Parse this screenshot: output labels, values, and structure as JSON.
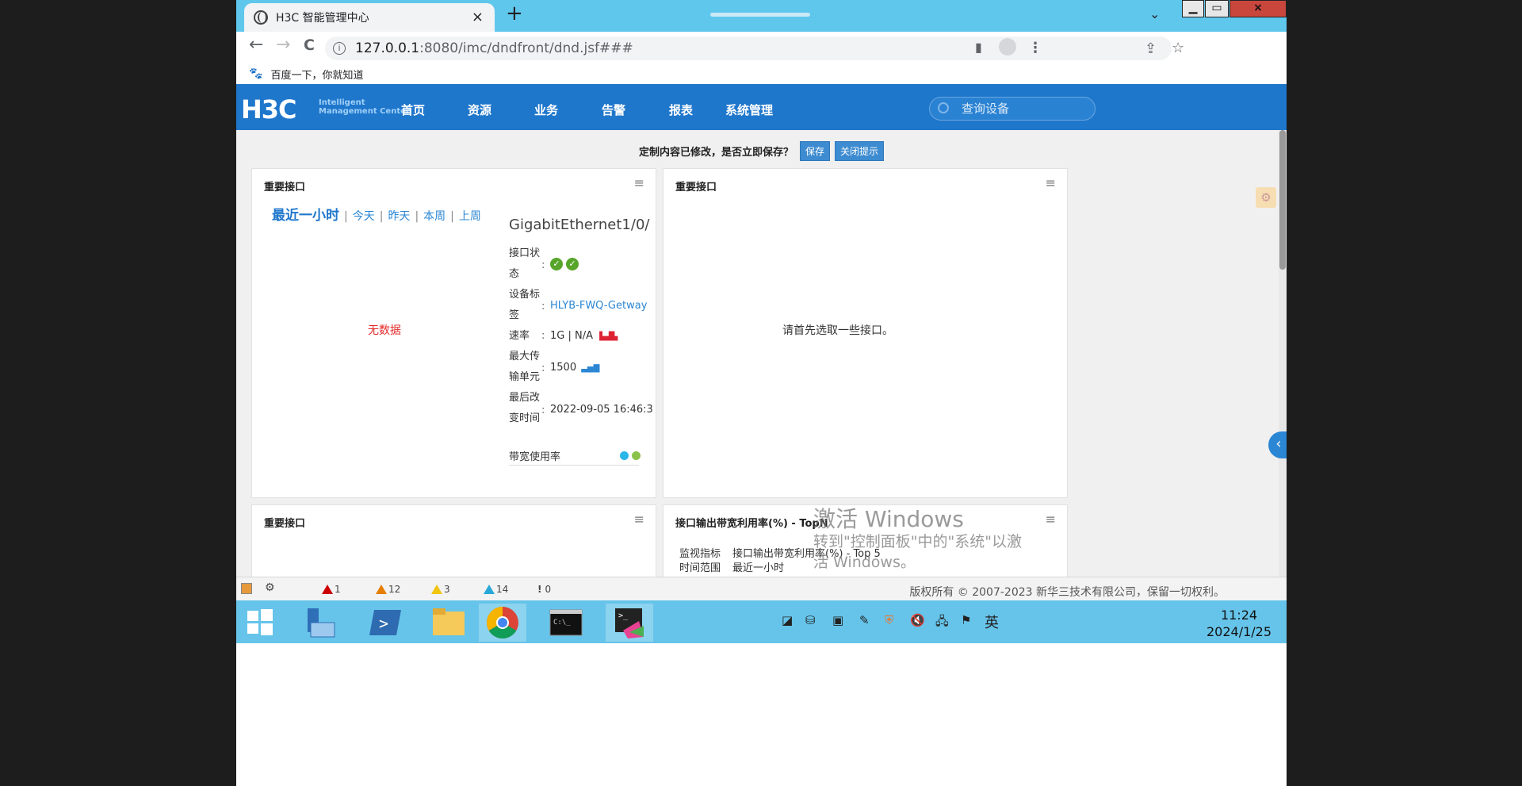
{
  "browser": {
    "tab_title": "H3C 智能管理中心",
    "tab_close": "×",
    "new_tab": "+",
    "tab_dropdown": "⌄",
    "win_min": "▁",
    "win_max": "▭",
    "win_close": "×",
    "back": "←",
    "forward": "→",
    "reload": "C",
    "url_host": "127.0.0.1",
    "url_rest": ":8080/imc/dndfront/dnd.jsf###",
    "bookmark": "百度一下，你就知道"
  },
  "app": {
    "logo": "H3C",
    "logo_sub_1": "Intelligent",
    "logo_sub_2": "Management Center",
    "menu": [
      "首页",
      "资源",
      "业务",
      "告警",
      "报表",
      "系统管理"
    ],
    "search_placeholder": "查询设备"
  },
  "notice": {
    "text": "定制内容已修改，是否立即保存？",
    "save_label": "保存",
    "close_label": "关闭提示"
  },
  "panels": {
    "p1": {
      "title": "重要接口",
      "time_links": [
        "最近一小时",
        "今天",
        "昨天",
        "本周",
        "上周"
      ],
      "sep": "|",
      "no_data": "无数据",
      "interface_name": "GigabitEthernet1/0/",
      "status_label_1": "接口状",
      "status_label_2": "态",
      "device_label_1": "设备标",
      "device_label_2": "签",
      "device_value": "HLYB-FWQ-Getway",
      "speed_label": "速率",
      "speed_value": "1G | N/A",
      "mtu_label_1": "最大传",
      "mtu_label_2": "输单元",
      "mtu_value": "1500",
      "changed_label_1": "最后改",
      "changed_label_2": "变时间",
      "changed_value": "2022-09-05 16:46:3",
      "bandwidth_label": "带宽使用率",
      "colon": ":"
    },
    "p2": {
      "title": "重要接口",
      "hint": "请首先选取一些接口。"
    },
    "p3": {
      "title": "重要接口"
    },
    "p4": {
      "title": "接口输出带宽利用率(%) - TopN",
      "row1_label": "监视指标",
      "row1_value": "接口输出带宽利用率(%) - Top 5",
      "row2_label": "时间范围",
      "row2_value": "最近一小时"
    }
  },
  "watermark": {
    "line1": "激活 Windows",
    "line2": "转到\"控制面板\"中的\"系统\"以激",
    "line3": "活 Windows。"
  },
  "statusbar": {
    "alarm_critical": "1",
    "alarm_major": "12",
    "alarm_minor": "3",
    "alarm_warning": "14",
    "alarm_info": "0",
    "copyright": "版权所有 © 2007-2023 新华三技术有限公司，保留一切权利。"
  },
  "taskbar": {
    "ime": "英",
    "time": "11:24",
    "date": "2024/1/25"
  },
  "colors": {
    "brand_blue": "#1f77cc",
    "link_blue": "#2b86d4",
    "critical": "#cc0000",
    "major": "#e67e00",
    "minor": "#f1c40f",
    "warning": "#29a8d8",
    "ok_green": "#58a52b"
  }
}
